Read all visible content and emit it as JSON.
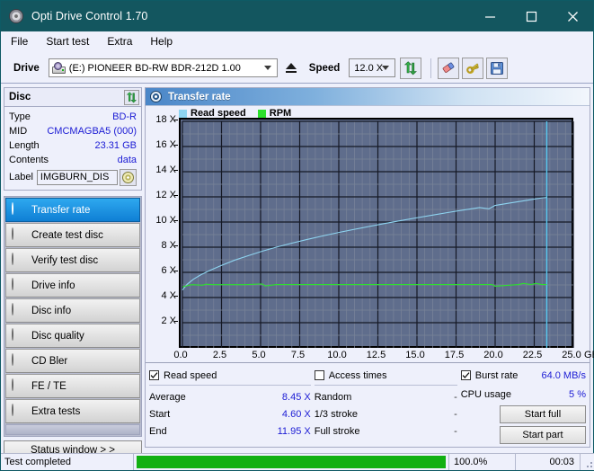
{
  "window": {
    "title": "Opti Drive Control 1.70",
    "icon": "disc-icon",
    "minimize_label": "Minimize",
    "maximize_label": "Maximize",
    "close_label": "Close"
  },
  "menu": {
    "items": [
      {
        "label": "File"
      },
      {
        "label": "Start test"
      },
      {
        "label": "Extra"
      },
      {
        "label": "Help"
      }
    ]
  },
  "toolbar": {
    "drive_label": "Drive",
    "drive_value": "(E:)  PIONEER BD-RW   BDR-212D 1.00",
    "eject_label": "Eject",
    "speed_label": "Speed",
    "speed_value": "12.0 X",
    "refresh_icon": "refresh-arrows-icon",
    "erase_icon": "eraser-icon",
    "key_icon": "keys-icon",
    "save_icon": "floppy-save-icon"
  },
  "disc_panel": {
    "title": "Disc",
    "refresh_icon": "refresh-arrows-icon",
    "rows": [
      {
        "key": "Type",
        "value": "BD-R"
      },
      {
        "key": "MID",
        "value": "CMCMAGBA5 (000)"
      },
      {
        "key": "Length",
        "value": "23.31 GB"
      },
      {
        "key": "Contents",
        "value": "data"
      }
    ],
    "label_key": "Label",
    "label_value": "IMGBURN_DIS",
    "label_button_icon": "disc-icon"
  },
  "nav": {
    "items": [
      {
        "label": "Transfer rate",
        "icon": "disc-icon",
        "active": true
      },
      {
        "label": "Create test disc",
        "icon": "disc-icon",
        "active": false
      },
      {
        "label": "Verify test disc",
        "icon": "disc-icon",
        "active": false
      },
      {
        "label": "Drive info",
        "icon": "disc-icon",
        "active": false
      },
      {
        "label": "Disc info",
        "icon": "disc-icon",
        "active": false
      },
      {
        "label": "Disc quality",
        "icon": "disc-icon",
        "active": false
      },
      {
        "label": "CD Bler",
        "icon": "disc-icon",
        "active": false
      },
      {
        "label": "FE / TE",
        "icon": "disc-icon",
        "active": false
      },
      {
        "label": "Extra tests",
        "icon": "disc-icon",
        "active": false
      }
    ],
    "status_window_label": "Status window > >"
  },
  "chart_panel": {
    "title": "Transfer rate",
    "icon": "disc-icon"
  },
  "chart_data": {
    "type": "line",
    "title": "Transfer rate",
    "xlabel": "GB",
    "ylabel": "X",
    "xlim": [
      0.0,
      25.0
    ],
    "ylim": [
      0,
      18
    ],
    "grid": true,
    "legend_position": "top-left",
    "x_unit_suffix": "GB",
    "y_unit_suffix": "X",
    "xticks": [
      0.0,
      2.5,
      5.0,
      7.5,
      10.0,
      12.5,
      15.0,
      17.5,
      20.0,
      22.5,
      25.0
    ],
    "xticklabels": [
      "0.0",
      "2.5",
      "5.0",
      "7.5",
      "10.0",
      "12.5",
      "15.0",
      "17.5",
      "20.0",
      "22.5",
      "25.0"
    ],
    "yticks": [
      2,
      4,
      6,
      8,
      10,
      12,
      14,
      16,
      18
    ],
    "yticklabels": [
      "2 X",
      "4 X",
      "6 X",
      "8 X",
      "10 X",
      "12 X",
      "14 X",
      "16 X",
      "18 X"
    ],
    "plot_bg": "#5f6d8c",
    "marker_x": 23.3,
    "marker_color": "#57c8ee",
    "series": [
      {
        "name": "Read speed",
        "color": "#8ed4f0",
        "x": [
          0.0,
          0.3,
          0.7,
          1.2,
          1.8,
          2.5,
          3.3,
          4.2,
          5.1,
          6.0,
          7.0,
          8.0,
          9.0,
          10.0,
          11.0,
          12.0,
          13.0,
          14.0,
          15.0,
          16.0,
          17.0,
          18.0,
          19.0,
          19.6,
          20.0,
          21.0,
          22.0,
          23.0,
          23.3
        ],
        "y": [
          4.6,
          5.05,
          5.45,
          5.82,
          6.18,
          6.55,
          6.95,
          7.32,
          7.68,
          8.0,
          8.32,
          8.62,
          8.9,
          9.17,
          9.42,
          9.66,
          9.9,
          10.12,
          10.34,
          10.55,
          10.76,
          10.96,
          11.15,
          11.05,
          11.32,
          11.52,
          11.72,
          11.92,
          11.95
        ]
      },
      {
        "name": "RPM",
        "color": "#2de02d",
        "x": [
          0.0,
          0.6,
          1.3,
          1.5,
          2.0,
          3.0,
          4.0,
          5.1,
          5.3,
          6.0,
          8.0,
          10.0,
          12.0,
          14.0,
          16.0,
          18.0,
          19.8,
          20.0,
          21.5,
          21.8,
          22.3,
          22.6,
          23.0,
          23.3
        ],
        "y": [
          4.85,
          5.02,
          4.98,
          5.06,
          5.02,
          5.02,
          5.02,
          5.08,
          4.92,
          5.03,
          5.03,
          5.03,
          5.03,
          5.03,
          5.03,
          5.03,
          5.03,
          4.9,
          5.03,
          5.12,
          5.03,
          5.12,
          5.03,
          5.03
        ]
      }
    ]
  },
  "stats": {
    "read_speed": {
      "checkbox_label": "Read speed",
      "checked": true,
      "rows": [
        {
          "key": "Average",
          "value": "8.45 X"
        },
        {
          "key": "Start",
          "value": "4.60 X"
        },
        {
          "key": "End",
          "value": "11.95 X"
        }
      ]
    },
    "access_times": {
      "checkbox_label": "Access times",
      "checked": false,
      "rows": [
        {
          "key": "Random",
          "value": "-"
        },
        {
          "key": "1/3 stroke",
          "value": "-"
        },
        {
          "key": "Full stroke",
          "value": "-"
        }
      ]
    },
    "burst": {
      "checkbox_label": "Burst rate",
      "checked": true,
      "value": "64.0 MB/s",
      "cpu_key": "CPU usage",
      "cpu_value": "5 %",
      "start_full_label": "Start full",
      "start_part_label": "Start part"
    }
  },
  "statusbar": {
    "message": "Test completed",
    "progress_percent": 100.0,
    "progress_text": "100.0%",
    "elapsed": "00:03",
    "progress_color": "#12b012"
  }
}
